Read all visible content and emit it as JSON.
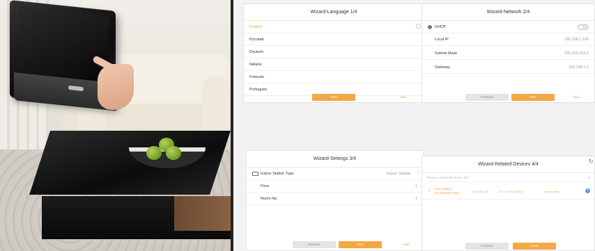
{
  "card1": {
    "title": "Wizard-Language 1/4",
    "languages": [
      "English",
      "Pусский",
      "Deutsch",
      "Italiano",
      "Français",
      "Português"
    ],
    "next_label": "Next",
    "skip_label": "Skip"
  },
  "card2": {
    "title": "Wizard-Network 2/4",
    "dhcp_label": "DHCP",
    "fields": [
      {
        "label": "Local IP",
        "value": "192.168.1.100"
      },
      {
        "label": "Subnet Mask",
        "value": "255.255.255.0"
      },
      {
        "label": "Gateway",
        "value": "192.168.1.1"
      }
    ],
    "previous_label": "Previous",
    "next_label": "Next",
    "skip_label": "Skip"
  },
  "card3": {
    "title": "Wizard-Settings 3/4",
    "station_type_label": "Indoor Station Type",
    "station_type_value": "Indoor Station",
    "floor_label": "Floor",
    "floor_value": "1",
    "room_label": "Room No.",
    "room_value": "1",
    "previous_label": "Previous",
    "next_label": "Next",
    "skip_label": "Skip"
  },
  "card4": {
    "title": "Wizard-Related Devices 4/4",
    "search_placeholder": "Please connect the device first",
    "device": {
      "name": "Door Station",
      "serial": "DS-KD8003-IME1",
      "ip": "192.168.1.80",
      "model": "V1.7.0 build 220510",
      "status": "Associated"
    },
    "previous_label": "Previous",
    "finish_label": "Finish"
  },
  "colors": {
    "accent": "#f4a742",
    "info": "#6a93d6"
  }
}
